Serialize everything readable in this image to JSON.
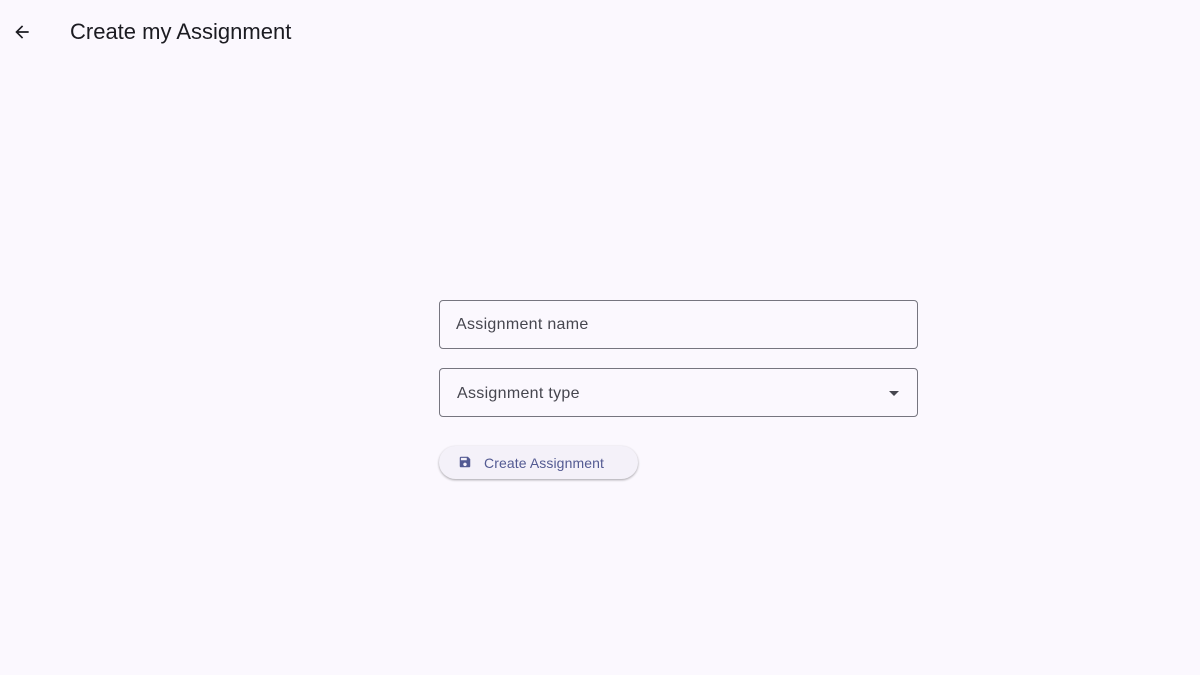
{
  "header": {
    "title": "Create my Assignment",
    "back_icon": "arrow-back-icon"
  },
  "form": {
    "name_field": {
      "placeholder": "Assignment name",
      "value": ""
    },
    "type_field": {
      "label": "Assignment type",
      "icon": "dropdown-arrow-icon"
    },
    "create_button": {
      "label": "Create Assignment",
      "icon": "save-icon"
    }
  },
  "colors": {
    "background": "#fbf8fe",
    "text": "#1b1b21",
    "outline": "#76757f",
    "button_text": "#535a92",
    "button_bg": "#f4f1f9"
  }
}
